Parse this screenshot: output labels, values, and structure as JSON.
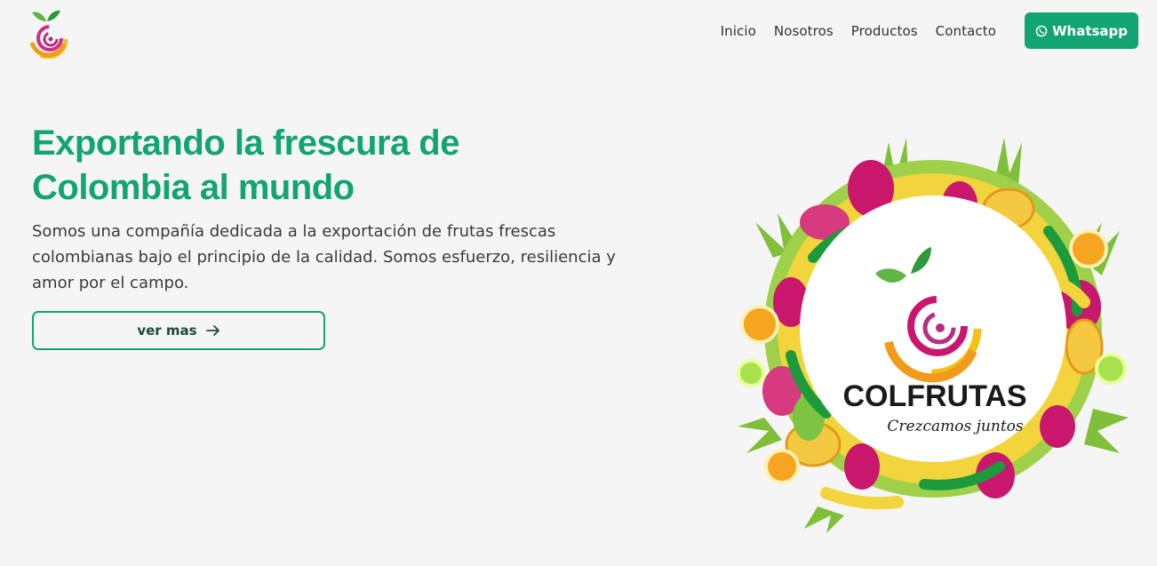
{
  "header": {
    "logo_icon": "colfrutas-fruit-logo-icon",
    "nav": [
      {
        "label": "Inicio"
      },
      {
        "label": "Nosotros"
      },
      {
        "label": "Productos"
      },
      {
        "label": "Contacto"
      }
    ],
    "whatsapp_button": {
      "label": "Whatsapp",
      "icon": "whatsapp-icon"
    }
  },
  "hero": {
    "title_line1": "Exportando la frescura de",
    "title_line2": "Colombia al mundo",
    "description": "Somos una compañía dedicada a la exportación de frutas frescas colombianas bajo el principio de la calidad. Somos esfuerzo, resiliencia y amor por el campo.",
    "more_button": {
      "label": "ver mas",
      "icon": "arrow-right-icon"
    }
  },
  "badge": {
    "brand": "COLFRUTAS",
    "tagline": "Crezcamos juntos",
    "icon": "fruit-wreath-illustration"
  },
  "colors": {
    "accent": "#13a570",
    "background": "#f5f5f5",
    "text": "#333333"
  }
}
